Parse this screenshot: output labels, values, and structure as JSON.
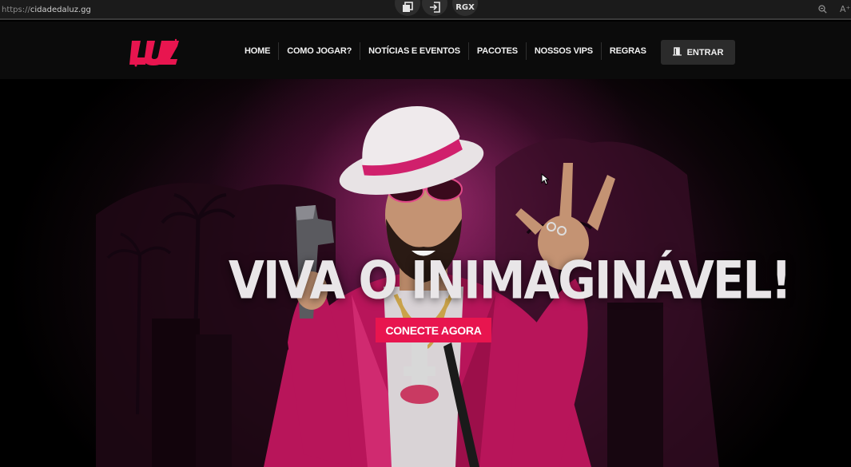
{
  "browser": {
    "url_protocol": "https://",
    "url_domain": "cidadedaluz.gg",
    "extensions": [
      "copy-icon",
      "login-icon",
      "RGX"
    ],
    "zoom_icon": "zoom-out-icon",
    "read_aloud_icon": "A⁺"
  },
  "header": {
    "logo_text": "LUZ",
    "nav": [
      "HOME",
      "COMO JOGAR?",
      "NOTÍCIAS E EVENTOS",
      "PACOTES",
      "NOSSOS VIPS",
      "REGRAS"
    ],
    "login_label": "ENTRAR",
    "login_icon": "door-icon"
  },
  "hero": {
    "headline": "VIVA O INIMAGINÁVEL!",
    "cta_label": "CONECTE AGORA"
  },
  "colors": {
    "accent": "#e8154f",
    "header_bg": "#0b0b0b",
    "button_bg": "#2b2b2b"
  }
}
